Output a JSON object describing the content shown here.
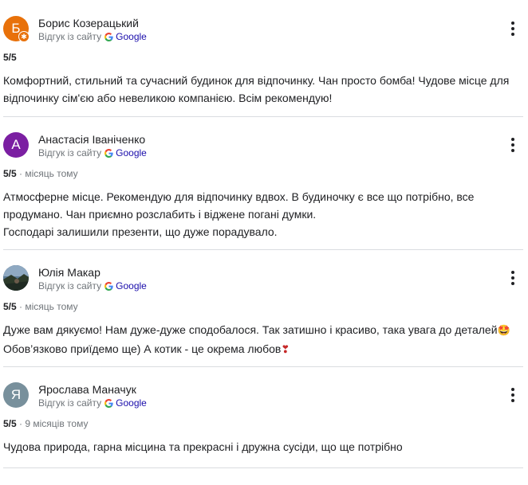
{
  "source_label": "Відгук із сайту",
  "google_label": "Google",
  "reviews": [
    {
      "author": "Борис Козерацький",
      "avatar_letter": "Б",
      "avatar_color": "#e8710a",
      "rating": "5/5",
      "time": "",
      "text_lines": [
        "Комфортний, стильний та сучасний будинок для відпочинку. Чан просто бомба! Чудове місце для відпочинку сім'єю або невеликою компанією. Всім рекомендую!"
      ]
    },
    {
      "author": "Анастасія Іваніченко",
      "avatar_letter": "А",
      "avatar_color": "#7b1fa2",
      "rating": "5/5",
      "time": "місяць тому",
      "text_lines": [
        "Атмосферне місце. Рекомендую для відпочинку вдвох. В будиночку є все що потрібно, все продумано. Чан приємно розслабить і віджене погані думки.",
        "Господарі залишили презенти, що дуже порадувало."
      ]
    },
    {
      "author": "Юлія Макар",
      "avatar_letter": "",
      "avatar_color": "#3a4a5c",
      "rating": "5/5",
      "time": "місяць тому",
      "text_line1": "Дуже вам дякуємо! Нам дуже-дуже сподобалося. Так затишно і красиво, така увага до деталей",
      "emoji1": "🤩",
      "text_line2": "Обов’язково приїдемо ще) А котик - це окрема любов",
      "emoji2": "❣"
    },
    {
      "author": "Ярослава Маначук",
      "avatar_letter": "Я",
      "avatar_color": "#78909c",
      "rating": "5/5",
      "time": "9 місяців тому",
      "text_lines": [
        "Чудова природа, гарна місцина та прекрасні і дружна сусіди, що ще потрібно"
      ]
    }
  ]
}
